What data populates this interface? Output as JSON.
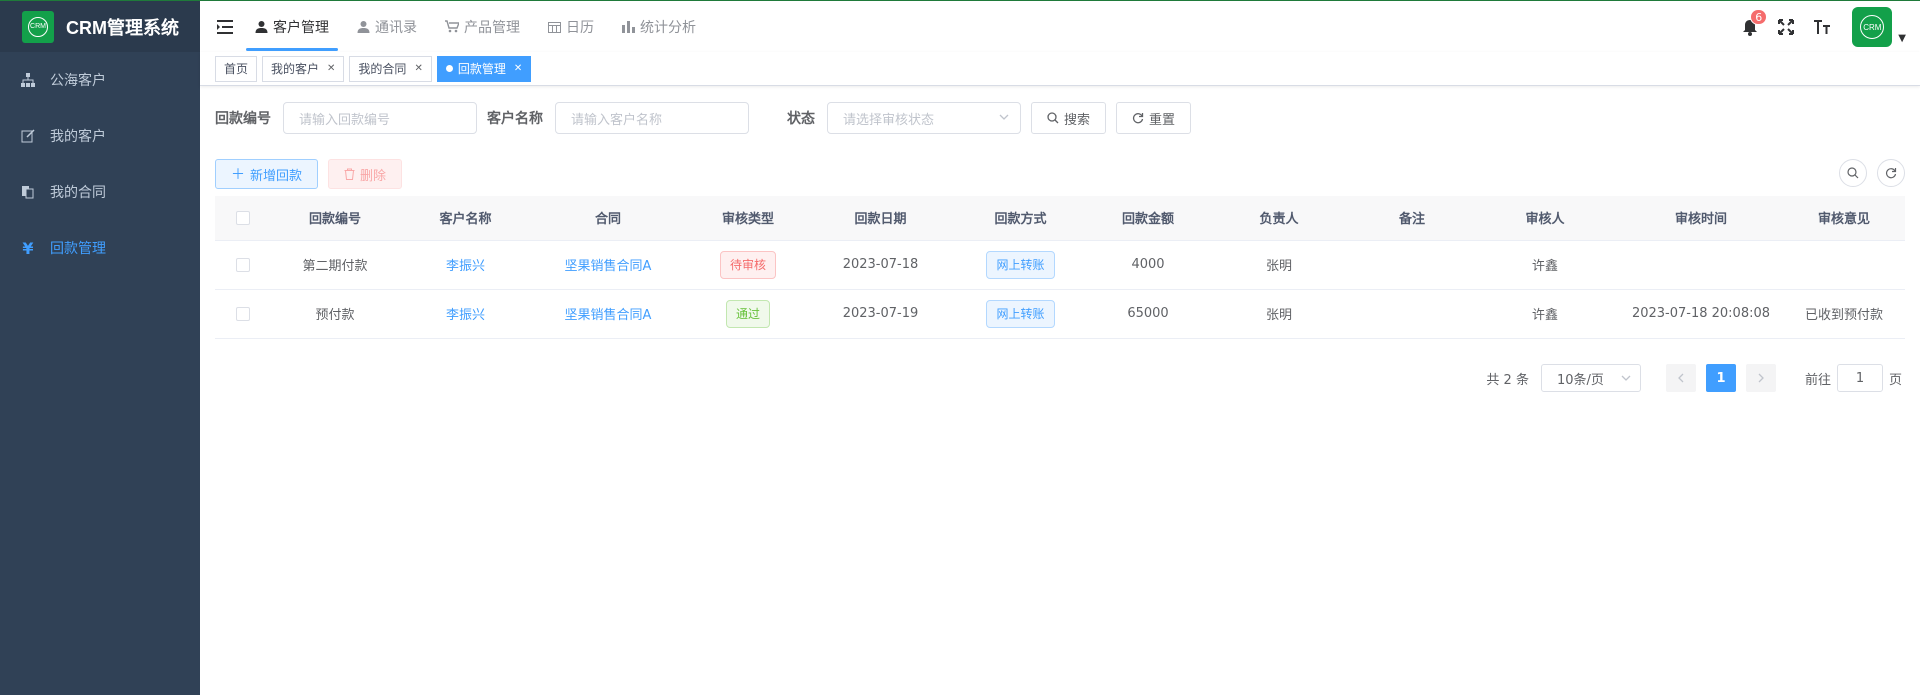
{
  "app": {
    "title": "CRM管理系统",
    "logo_text": "CRM"
  },
  "sidebar": {
    "items": [
      {
        "label": "公海客户",
        "icon": "tree-icon"
      },
      {
        "label": "我的客户",
        "icon": "edit-icon"
      },
      {
        "label": "我的合同",
        "icon": "documents-icon"
      },
      {
        "label": "回款管理",
        "icon": "yen-icon",
        "active": true
      }
    ]
  },
  "header": {
    "nav": [
      {
        "label": "客户管理",
        "icon": "user-icon",
        "active": true
      },
      {
        "label": "通讯录",
        "icon": "user-icon"
      },
      {
        "label": "产品管理",
        "icon": "cart-icon"
      },
      {
        "label": "日历",
        "icon": "calendar-icon"
      },
      {
        "label": "统计分析",
        "icon": "bar-chart-icon"
      }
    ],
    "notification_count": "6",
    "avatar_text": "CRM"
  },
  "tags": [
    {
      "label": "首页"
    },
    {
      "label": "我的客户"
    },
    {
      "label": "我的合同"
    },
    {
      "label": "回款管理",
      "active": true
    }
  ],
  "search": {
    "f1_label": "回款编号",
    "f1_placeholder": "请输入回款编号",
    "f2_label": "客户名称",
    "f2_placeholder": "请输入客户名称",
    "f3_label": "状态",
    "f3_placeholder": "请选择审核状态",
    "search_btn": "搜索",
    "reset_btn": "重置"
  },
  "toolbar": {
    "add_label": "新增回款",
    "delete_label": "删除"
  },
  "table": {
    "columns": [
      "回款编号",
      "客户名称",
      "合同",
      "审核类型",
      "回款日期",
      "回款方式",
      "回款金额",
      "负责人",
      "备注",
      "审核人",
      "审核时间",
      "审核意见"
    ],
    "rows": [
      {
        "no": "第二期付款",
        "customer": "李振兴",
        "contract": "坚果销售合同A",
        "status": "待审核",
        "date": "2023-07-18",
        "method": "网上转账",
        "amount": "4000",
        "owner": "张明",
        "remark": "",
        "auditor": "许鑫",
        "audit_time": "",
        "opinion": ""
      },
      {
        "no": "预付款",
        "customer": "李振兴",
        "contract": "坚果销售合同A",
        "status": "通过",
        "date": "2023-07-19",
        "method": "网上转账",
        "amount": "65000",
        "owner": "张明",
        "remark": "",
        "auditor": "许鑫",
        "audit_time": "2023-07-18 20:08:08",
        "opinion": "已收到预付款"
      }
    ]
  },
  "pagination": {
    "total": "共 2 条",
    "page_size": "10条/页",
    "current": "1",
    "goto_label": "前往",
    "goto_value": "1",
    "page_suffix": "页"
  },
  "colors": {
    "sidebar_bg": "#304156",
    "accent": "#409eff",
    "brand_green": "#13a04a"
  }
}
